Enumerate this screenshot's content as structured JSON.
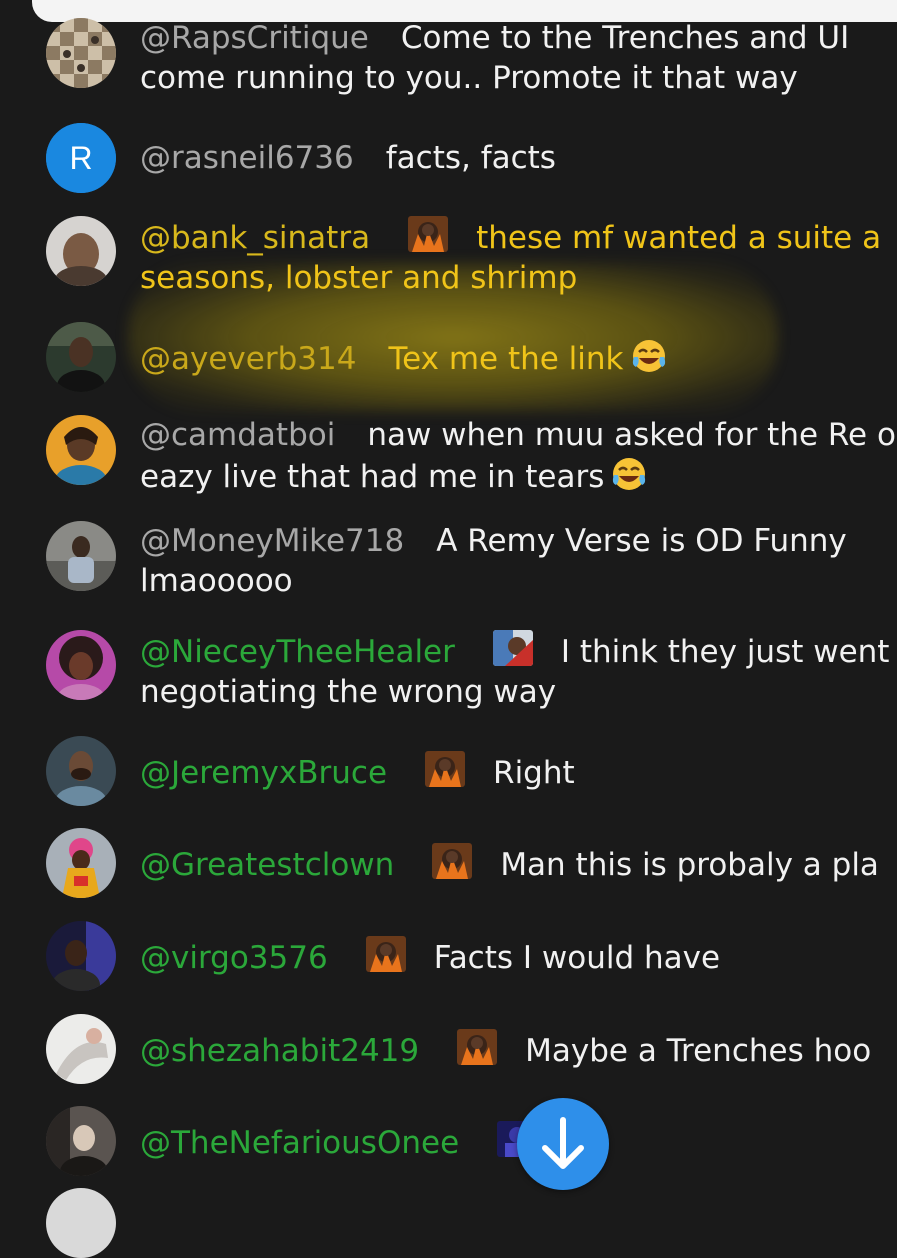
{
  "comments": [
    {
      "handle": "@RapsCritique",
      "member": false,
      "badge": false,
      "text": "Come to the Trenches and UI come running to you.. Promote it that way",
      "avatar": "chessboard"
    },
    {
      "handle": "@rasneil6736",
      "member": false,
      "badge": false,
      "text": "facts, facts",
      "avatar": "letter",
      "avatar_letter": "R",
      "avatar_color": "#1a88e0"
    },
    {
      "handle": "@bank_sinatra",
      "member": true,
      "badge": true,
      "text": "these mf wanted a suite a seasons, lobster and shrimp",
      "avatar": "photo"
    },
    {
      "handle": "@ayeverb314",
      "member": false,
      "badge": false,
      "text": "Tex me the link",
      "emoji": "tears-of-joy",
      "avatar": "photo"
    },
    {
      "handle": "@camdatboi",
      "member": false,
      "badge": false,
      "text": "naw when muu asked for the Re on eazy live that had me in tears",
      "emoji": "tears-of-joy",
      "avatar": "photo"
    },
    {
      "handle": "@MoneyMike718",
      "member": false,
      "badge": false,
      "text": "A Remy Verse is OD Funny lmaooooo",
      "avatar": "photo"
    },
    {
      "handle": "@NieceyTheeHealer",
      "member": true,
      "badge": true,
      "text": "I think they just went negotiating the wrong way",
      "avatar": "photo"
    },
    {
      "handle": "@JeremyxBruce",
      "member": true,
      "badge": true,
      "text": "Right",
      "avatar": "photo"
    },
    {
      "handle": "@Greatestclown",
      "member": true,
      "badge": true,
      "text": "Man this is probaly a pla",
      "avatar": "photo"
    },
    {
      "handle": "@virgo3576",
      "member": true,
      "badge": true,
      "text": "Facts I would have",
      "avatar": "photo"
    },
    {
      "handle": "@shezahabit2419",
      "member": true,
      "badge": true,
      "text": "Maybe a Trenches hoo",
      "avatar": "photo"
    },
    {
      "handle": "@TheNefariousOnee",
      "member": true,
      "badge": true,
      "text": "",
      "avatar": "photo"
    }
  ],
  "scroll_button_icon": "arrow-down-icon",
  "colors": {
    "background": "#1a1a1a",
    "member_handle": "#2ba83a",
    "handle": "#a8a8a8",
    "highlight_text": "#f0c419",
    "scroll_button": "#2e8fea"
  }
}
